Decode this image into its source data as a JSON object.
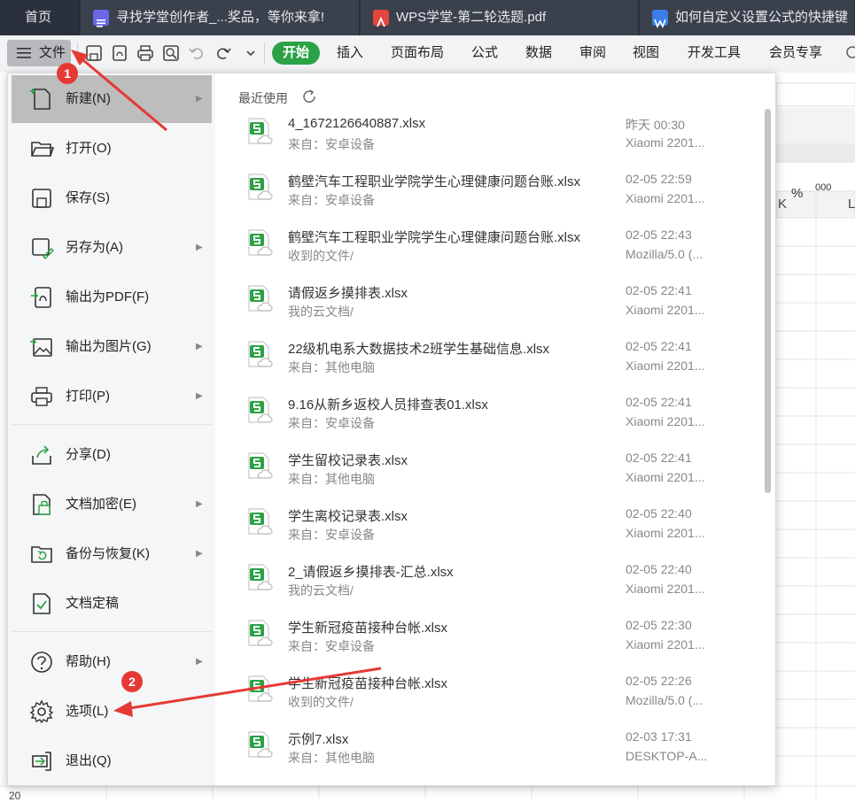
{
  "tabs": [
    {
      "label": "首页",
      "icon": ""
    },
    {
      "label": "寻找学堂创作者_...奖品，等你来拿!",
      "icon": "doc-icon"
    },
    {
      "label": "WPS学堂-第二轮选题.pdf",
      "icon": "pdf-icon"
    },
    {
      "label": "如何自定义设置公式的快捷键",
      "icon": "word-icon"
    }
  ],
  "toolbar": {
    "file_label": "文件",
    "ribbon": [
      "开始",
      "插入",
      "页面布局",
      "公式",
      "数据",
      "审阅",
      "视图",
      "开发工具",
      "会员专享"
    ]
  },
  "sheet": {
    "col_k": "K",
    "col_l": "L",
    "row_last": "20",
    "fmt_percent": "%",
    "fmt_thousand": "000"
  },
  "menu": {
    "items": [
      {
        "label": "新建(N)",
        "icon": "new-file-icon",
        "arrow": true
      },
      {
        "label": "打开(O)",
        "icon": "folder-open-icon",
        "arrow": false
      },
      {
        "label": "保存(S)",
        "icon": "save-icon",
        "arrow": false
      },
      {
        "label": "另存为(A)",
        "icon": "save-as-icon",
        "arrow": true
      },
      {
        "label": "输出为PDF(F)",
        "icon": "export-pdf-icon",
        "arrow": false
      },
      {
        "label": "输出为图片(G)",
        "icon": "export-image-icon",
        "arrow": true
      },
      {
        "label": "打印(P)",
        "icon": "print-icon",
        "arrow": true
      },
      {
        "label": "分享(D)",
        "icon": "share-icon",
        "arrow": false
      },
      {
        "label": "文档加密(E)",
        "icon": "encrypt-icon",
        "arrow": true
      },
      {
        "label": "备份与恢复(K)",
        "icon": "backup-icon",
        "arrow": true
      },
      {
        "label": "文档定稿",
        "icon": "finalize-icon",
        "arrow": false
      },
      {
        "label": "帮助(H)",
        "icon": "help-icon",
        "arrow": true
      },
      {
        "label": "选项(L)",
        "icon": "gear-icon",
        "arrow": false
      },
      {
        "label": "退出(Q)",
        "icon": "exit-icon",
        "arrow": false
      }
    ]
  },
  "recent": {
    "title": "最近使用",
    "files": [
      {
        "name": "4_1672126640887.xlsx",
        "source": "来自：安卓设备",
        "date": "昨天  00:30",
        "device": "Xiaomi 2201..."
      },
      {
        "name": "鹤壁汽车工程职业学院学生心理健康问题台账.xlsx",
        "source": "来自：安卓设备",
        "date": "02-05 22:59",
        "device": "Xiaomi 2201..."
      },
      {
        "name": "鹤壁汽车工程职业学院学生心理健康问题台账.xlsx",
        "source": "收到的文件/",
        "date": "02-05 22:43",
        "device": "Mozilla/5.0 (..."
      },
      {
        "name": "请假返乡摸排表.xlsx",
        "source": "我的云文档/",
        "date": "02-05 22:41",
        "device": "Xiaomi 2201..."
      },
      {
        "name": "22级机电系大数据技术2班学生基础信息.xlsx",
        "source": "来自：其他电脑",
        "date": "02-05 22:41",
        "device": "Xiaomi 2201..."
      },
      {
        "name": "9.16从新乡返校人员排查表01.xlsx",
        "source": "来自：安卓设备",
        "date": "02-05 22:41",
        "device": "Xiaomi 2201..."
      },
      {
        "name": "学生留校记录表.xlsx",
        "source": "来自：其他电脑",
        "date": "02-05 22:41",
        "device": "Xiaomi 2201..."
      },
      {
        "name": "学生离校记录表.xlsx",
        "source": "来自：安卓设备",
        "date": "02-05 22:40",
        "device": "Xiaomi 2201..."
      },
      {
        "name": "2_请假返乡摸排表-汇总.xlsx",
        "source": "我的云文档/",
        "date": "02-05 22:40",
        "device": "Xiaomi 2201..."
      },
      {
        "name": "学生新冠疫苗接种台帐.xlsx",
        "source": "来自：安卓设备",
        "date": "02-05 22:30",
        "device": "Xiaomi 2201..."
      },
      {
        "name": "学生新冠疫苗接种台帐.xlsx",
        "source": "收到的文件/",
        "date": "02-05 22:26",
        "device": "Mozilla/5.0 (..."
      },
      {
        "name": "示例7.xlsx",
        "source": "来自：其他电脑",
        "date": "02-03 17:31",
        "device": "DESKTOP-A..."
      }
    ]
  },
  "annotations": {
    "badge1": "1",
    "badge2": "2"
  },
  "colors": {
    "accent": "#2ba245",
    "tabbar": "#2b313c",
    "annotation": "#e53935"
  }
}
